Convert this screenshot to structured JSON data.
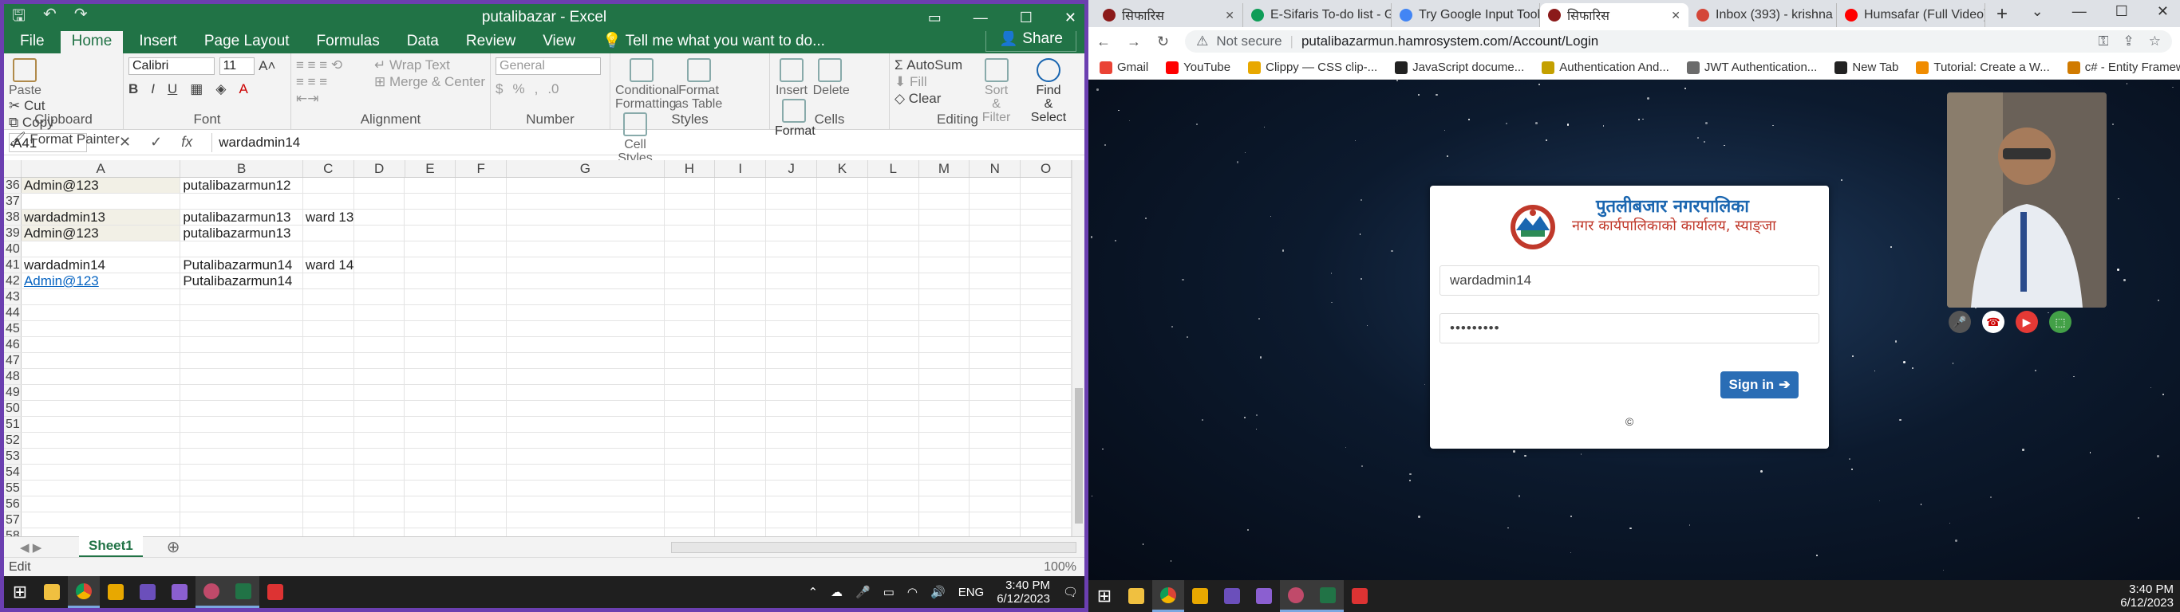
{
  "excel": {
    "qat_icons": [
      "save-icon",
      "undo-icon",
      "redo-icon"
    ],
    "title": "putalibazar - Excel",
    "tabs": [
      "File",
      "Home",
      "Insert",
      "Page Layout",
      "Formulas",
      "Data",
      "Review",
      "View"
    ],
    "active_tab": "Home",
    "tell_me": "Tell me what you want to do...",
    "share": "Share",
    "ribbon": {
      "paste": "Paste",
      "cut": "Cut",
      "copy": "Copy",
      "format_painter": "Format Painter",
      "clipboard": "Clipboard",
      "font_name": "Calibri",
      "font_size": "11",
      "font": "Font",
      "wrap_text": "Wrap Text",
      "merge_center": "Merge & Center",
      "alignment": "Alignment",
      "number_format": "General",
      "number": "Number",
      "conditional": "Conditional Formatting",
      "format_table": "Format as Table",
      "cell_styles": "Cell Styles",
      "styles": "Styles",
      "insert": "Insert",
      "delete": "Delete",
      "format": "Format",
      "cells": "Cells",
      "autosum": "AutoSum",
      "fill": "Fill",
      "clear": "Clear",
      "sort_filter": "Sort & Filter",
      "find_select": "Find & Select",
      "editing": "Editing"
    },
    "name_box": "A41",
    "formula_value": "wardadmin14",
    "columns": [
      "A",
      "B",
      "C",
      "D",
      "E",
      "F",
      "G",
      "H",
      "I",
      "J",
      "K",
      "L",
      "M",
      "N",
      "O"
    ],
    "rows": [
      {
        "n": "36",
        "a": "Admin@123",
        "b": "putalibazarmun12",
        "c": ""
      },
      {
        "n": "37",
        "a": "",
        "b": "",
        "c": ""
      },
      {
        "n": "38",
        "a": "wardadmin13",
        "b": "putalibazarmun13",
        "c": "ward 13"
      },
      {
        "n": "39",
        "a": "Admin@123",
        "b": "putalibazarmun13",
        "c": ""
      },
      {
        "n": "40",
        "a": "",
        "b": "",
        "c": ""
      },
      {
        "n": "41",
        "a": "wardadmin14",
        "b": "Putalibazarmun14",
        "c": "ward 14"
      },
      {
        "n": "42",
        "a": "Admin@123",
        "b": "Putalibazarmun14",
        "c": ""
      },
      {
        "n": "43",
        "a": "",
        "b": "",
        "c": ""
      },
      {
        "n": "44",
        "a": "",
        "b": "",
        "c": ""
      },
      {
        "n": "45",
        "a": "",
        "b": "",
        "c": ""
      },
      {
        "n": "46",
        "a": "",
        "b": "",
        "c": ""
      },
      {
        "n": "47",
        "a": "",
        "b": "",
        "c": ""
      },
      {
        "n": "48",
        "a": "",
        "b": "",
        "c": ""
      },
      {
        "n": "49",
        "a": "",
        "b": "",
        "c": ""
      },
      {
        "n": "50",
        "a": "",
        "b": "",
        "c": ""
      },
      {
        "n": "51",
        "a": "",
        "b": "",
        "c": ""
      },
      {
        "n": "52",
        "a": "",
        "b": "",
        "c": ""
      },
      {
        "n": "53",
        "a": "",
        "b": "",
        "c": ""
      },
      {
        "n": "54",
        "a": "",
        "b": "",
        "c": ""
      },
      {
        "n": "55",
        "a": "",
        "b": "",
        "c": ""
      },
      {
        "n": "56",
        "a": "",
        "b": "",
        "c": ""
      },
      {
        "n": "57",
        "a": "",
        "b": "",
        "c": ""
      },
      {
        "n": "58",
        "a": "",
        "b": "",
        "c": ""
      }
    ],
    "sheet_tab": "Sheet1",
    "status": "Edit",
    "zoom": "100%"
  },
  "chrome": {
    "tabs": [
      {
        "title": "सिफारिस",
        "fav": "#8b1a1a"
      },
      {
        "title": "E-Sifaris To-do list - Google",
        "fav": "#0f9d58"
      },
      {
        "title": "Try Google Input Tools",
        "fav": "#4285f4"
      },
      {
        "title": "सिफारिस",
        "fav": "#8b1a1a"
      },
      {
        "title": "Inbox (393) - krishna",
        "fav": "#d44638"
      },
      {
        "title": "Humsafar (Full Video)",
        "fav": "#ff0000"
      }
    ],
    "active_tab_index": 3,
    "not_secure": "Not secure",
    "url": "putalibazarmun.hamrosystem.com/Account/Login",
    "bookmarks": [
      "Gmail",
      "YouTube",
      "Clippy — CSS clip-...",
      "JavaScript docume...",
      "Authentication And...",
      "JWT Authentication...",
      "New Tab",
      "Tutorial: Create a W...",
      "c# - Entity Framew..."
    ],
    "login": {
      "org_name": "पुतलीबजार नगरपालिका",
      "org_sub": "नगर कार्यपालिकाको कार्यालय, स्याङ्जा",
      "username": "wardadmin14",
      "password": "•••••••••",
      "signin": "Sign in",
      "copyright": "©"
    }
  },
  "taskbar": {
    "lang": "ENG",
    "time": "3:40 PM",
    "date": "6/12/2023"
  }
}
